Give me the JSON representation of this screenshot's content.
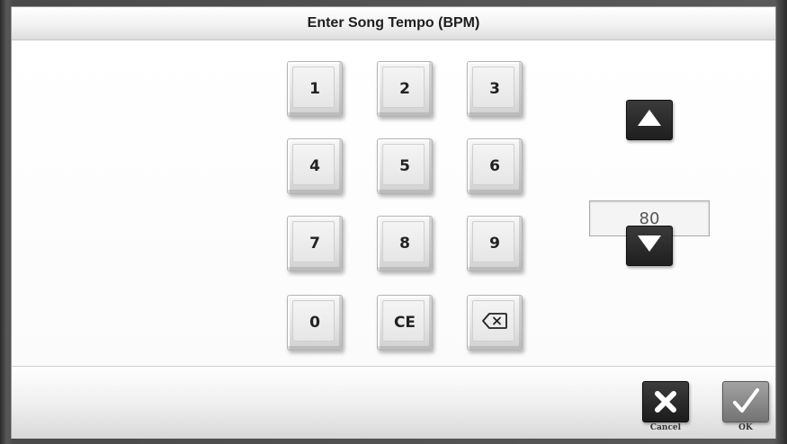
{
  "dialog": {
    "title": "Enter Song Tempo (BPM)"
  },
  "keypad": {
    "keys": [
      "1",
      "2",
      "3",
      "4",
      "5",
      "6",
      "7",
      "8",
      "9",
      "0",
      "CE"
    ],
    "backspace_icon": "backspace-icon"
  },
  "tempo": {
    "value": "80",
    "increment_icon": "triangle-up-icon",
    "decrement_icon": "triangle-down-icon"
  },
  "footer": {
    "cancel_label": "Cancel",
    "ok_label": "OK",
    "cancel_icon": "x-mark-icon",
    "ok_icon": "checkmark-icon"
  },
  "colors": {
    "dark_button": "#262626",
    "ok_button": "#8a8a8a"
  }
}
